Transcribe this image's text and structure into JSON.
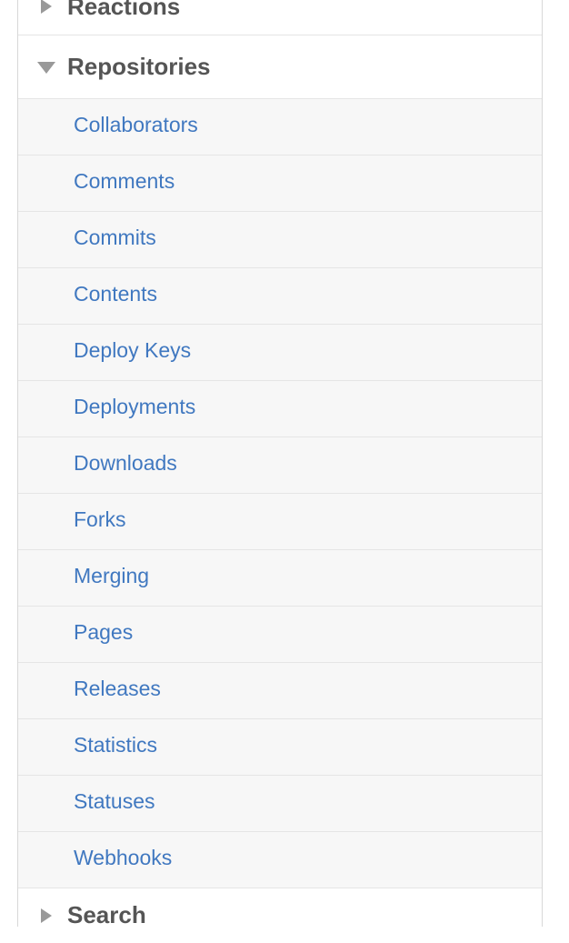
{
  "sections": {
    "reactions": {
      "label": "Reactions",
      "expanded": false
    },
    "repositories": {
      "label": "Repositories",
      "expanded": true,
      "items": [
        "Collaborators",
        "Comments",
        "Commits",
        "Contents",
        "Deploy Keys",
        "Deployments",
        "Downloads",
        "Forks",
        "Merging",
        "Pages",
        "Releases",
        "Statistics",
        "Statuses",
        "Webhooks"
      ]
    },
    "search": {
      "label": "Search",
      "expanded": false
    }
  },
  "icons": {
    "collapsed": "triangle-right-icon",
    "expanded": "triangle-down-icon"
  },
  "colors": {
    "link": "#4078c0",
    "header_text": "#555555",
    "triangle": "#999999",
    "item_bg": "#f7f7f7",
    "border": "#e5e5e5"
  }
}
